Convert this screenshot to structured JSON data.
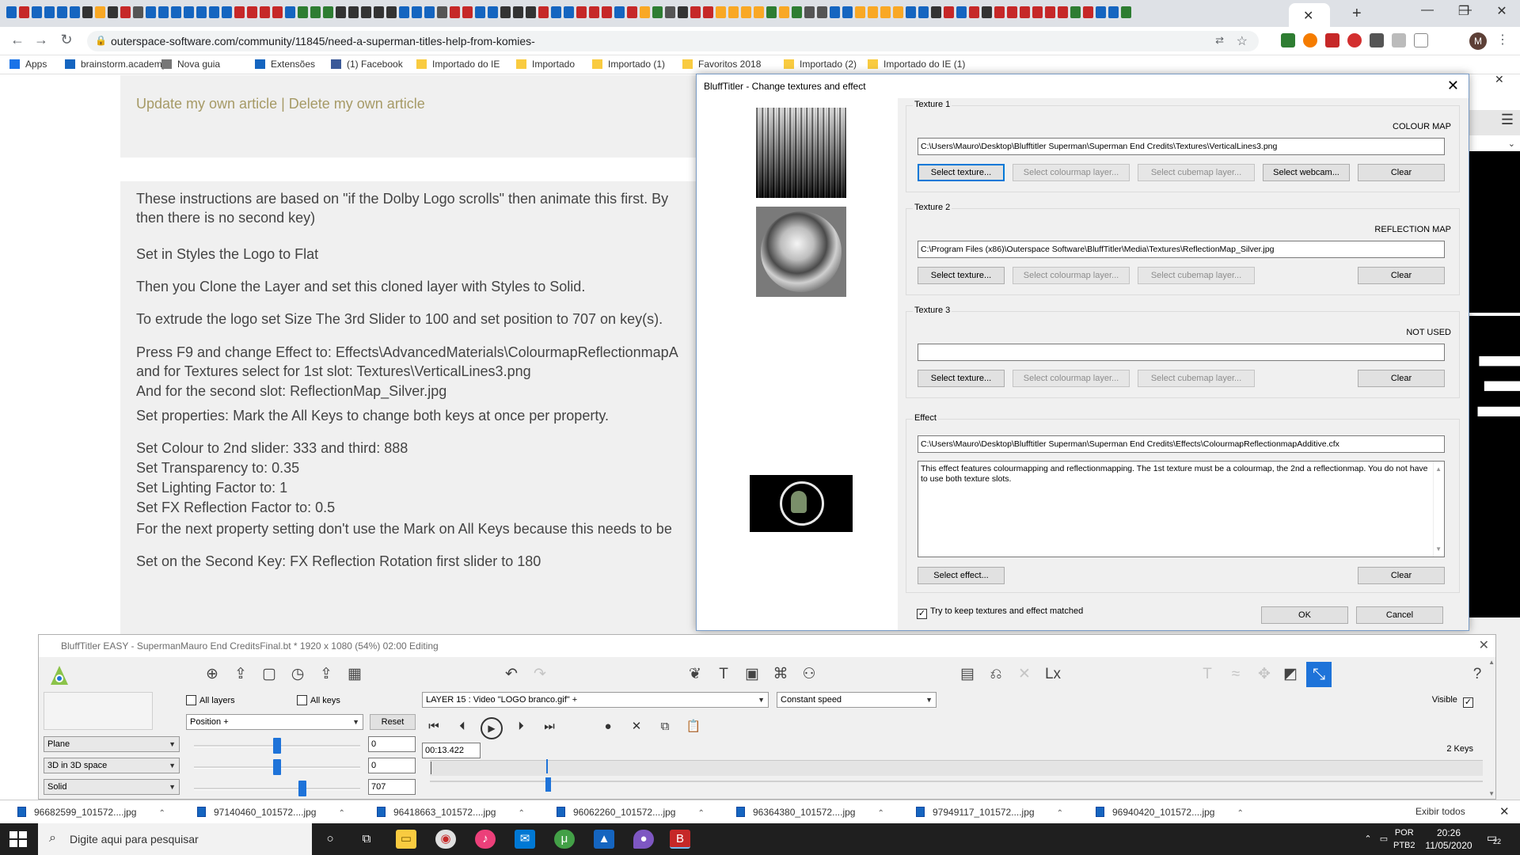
{
  "browser": {
    "favicon_colors": [
      "#1565c0",
      "#c62828",
      "#1565c0",
      "#1565c0",
      "#1565c0",
      "#1565c0",
      "#333333",
      "#f9a825",
      "#333333",
      "#c62828",
      "#555555",
      "#1565c0",
      "#1565c0",
      "#1565c0",
      "#1565c0",
      "#1565c0",
      "#1565c0",
      "#1565c0",
      "#c62828",
      "#c62828",
      "#c62828",
      "#c62828",
      "#1565c0",
      "#2e7d32",
      "#2e7d32",
      "#2e7d32",
      "#333333",
      "#333333",
      "#333333",
      "#333333",
      "#333333",
      "#1565c0",
      "#1565c0",
      "#1565c0",
      "#555555",
      "#c62828",
      "#c62828",
      "#1565c0",
      "#1565c0",
      "#333333",
      "#333333",
      "#333333",
      "#c62828",
      "#1565c0",
      "#1565c0",
      "#c62828",
      "#c62828",
      "#c62828",
      "#1565c0",
      "#c62828",
      "#f9a825",
      "#2e7d32",
      "#555555",
      "#333333",
      "#c62828",
      "#c62828",
      "#f9a825",
      "#f9a825",
      "#f9a825",
      "#f9a825",
      "#2e7d32",
      "#f9a825",
      "#2e7d32",
      "#555555",
      "#555555",
      "#1565c0",
      "#1565c0",
      "#f9a825",
      "#f9a825",
      "#f9a825",
      "#f9a825",
      "#1565c0",
      "#1565c0",
      "#333333",
      "#c62828",
      "#1565c0",
      "#c62828",
      "#333333",
      "#c62828",
      "#c62828",
      "#c62828",
      "#c62828",
      "#c62828",
      "#c62828",
      "#2e7d32",
      "#c62828",
      "#1565c0",
      "#1565c0",
      "#2e7d32"
    ],
    "active_tab_close": "✕",
    "new_tab": "+",
    "window_minimize": "—",
    "window_restore": "❐",
    "window_close": "✕",
    "back": "←",
    "forward": "→",
    "reload": "↻",
    "url": "outerspace-software.com/community/11845/need-a-superman-titles-help-from-komies-",
    "avatar_letter": "M",
    "bookmarks": [
      {
        "label": "Apps",
        "icon": "apps-icon",
        "color": "#1a73e8"
      },
      {
        "label": "brainstorm.academy",
        "icon": "arrow-icon",
        "color": "#1565c0"
      },
      {
        "label": "Nova guia",
        "icon": "globe-icon",
        "color": "#777777"
      },
      {
        "label": "Extensões",
        "icon": "puzzle-icon",
        "color": "#1565c0"
      },
      {
        "label": "(1) Facebook",
        "icon": "facebook-icon",
        "color": "#3b5998"
      },
      {
        "label": "Importado do IE",
        "icon": "folder-icon",
        "color": "#f9cb40"
      },
      {
        "label": "Importado",
        "icon": "folder-icon",
        "color": "#f9cb40"
      },
      {
        "label": "Importado (1)",
        "icon": "folder-icon",
        "color": "#f9cb40"
      },
      {
        "label": "Favoritos 2018",
        "icon": "folder-icon",
        "color": "#f9cb40"
      },
      {
        "label": "Importado (2)",
        "icon": "folder-icon",
        "color": "#f9cb40"
      },
      {
        "label": "Importado do IE (1)",
        "icon": "folder-icon",
        "color": "#f9cb40"
      }
    ]
  },
  "article": {
    "links": "Update my own article | Delete my own article",
    "lines": [
      "These instructions are based on \"if the Dolby Logo scrolls\" then animate this first. By",
      "then there is no second key)",
      "Set in Styles the Logo to Flat",
      "Then you Clone the Layer and set this cloned layer with Styles to Solid.",
      "To extrude the logo set Size The 3rd Slider to 100 and set position to 707 on key(s).",
      "Press F9 and change Effect to: Effects\\AdvancedMaterials\\ColourmapReflectionmapA",
      "and for Textures select for 1st slot: Textures\\VerticalLines3.png",
      "And for the second slot: ReflectionMap_Silver.jpg",
      "Set properties: Mark the All Keys to change both keys at once per property.",
      "Set Colour to 2nd slider: 333 and third: 888",
      "Set Transparency to: 0.35",
      "Set Lighting Factor to: 1",
      "Set FX Reflection Factor to: 0.5",
      "For the next property setting don't use the Mark on All Keys because this needs to be",
      "Set on the Second Key: FX Reflection Rotation first slider to 180"
    ]
  },
  "dialog": {
    "title": "BluffTitler - Change textures and effect",
    "close": "✕",
    "texture1": {
      "legend": "Texture 1",
      "map_type": "COLOUR MAP",
      "path": "C:\\Users\\Mauro\\Desktop\\Blufftitler Superman\\Superman End Credits\\Textures\\VerticalLines3.png",
      "select_texture": "Select texture...",
      "select_colourmap": "Select colourmap layer...",
      "select_cubemap": "Select cubemap layer...",
      "select_webcam": "Select webcam...",
      "clear": "Clear"
    },
    "texture2": {
      "legend": "Texture 2",
      "map_type": "REFLECTION MAP",
      "path": "C:\\Program Files (x86)\\Outerspace Software\\BluffTitler\\Media\\Textures\\ReflectionMap_Silver.jpg",
      "select_texture": "Select texture...",
      "select_colourmap": "Select colourmap layer...",
      "select_cubemap": "Select cubemap layer...",
      "clear": "Clear"
    },
    "texture3": {
      "legend": "Texture 3",
      "map_type": "NOT USED",
      "path": "",
      "select_texture": "Select texture...",
      "select_colourmap": "Select colourmap layer...",
      "select_cubemap": "Select cubemap layer...",
      "clear": "Clear"
    },
    "effect": {
      "legend": "Effect",
      "path": "C:\\Users\\Mauro\\Desktop\\Blufftitler Superman\\Superman End Credits\\Effects\\ColourmapReflectionmapAdditive.cfx",
      "description": "This effect features colourmapping and reflectionmapping. The 1st texture must be a colourmap, the 2nd a reflectionmap. You do not have to use both texture slots.",
      "select_effect": "Select effect...",
      "clear": "Clear"
    },
    "keep_matched": "Try to keep textures and effect matched",
    "keep_matched_checked": true,
    "ok": "OK",
    "cancel": "Cancel"
  },
  "blufftitler": {
    "title": "BluffTitler EASY - SupermanMauro End CreditsFinal.bt * 1920 x 1080 (54%) 02:00 Editing",
    "close": "✕",
    "all_layers": "All layers",
    "all_keys": "All keys",
    "property": "Position +",
    "reset": "Reset",
    "layer": "LAYER 15   : Video \"LOGO branco.gif\" +",
    "speed": "Constant speed",
    "visible": "Visible",
    "visible_checked": true,
    "time": "00:13.422",
    "keys": "2 Keys",
    "style1": "Plane",
    "style2": "3D in 3D space",
    "style3": "Solid",
    "slider1_fraction": 0.5,
    "slider2_fraction": 0.5,
    "slider3_fraction": 0.65,
    "value1": "0",
    "value2": "0",
    "value3": "707",
    "accent": "#1e73d9"
  },
  "downloads": {
    "files": [
      "96682599_101572....jpg",
      "97140460_101572....jpg",
      "96418663_101572....jpg",
      "96062260_101572....jpg",
      "96364380_101572....jpg",
      "97949117_101572....jpg",
      "96940420_101572....jpg"
    ],
    "show_all": "Exibir todos",
    "close": "✕"
  },
  "taskbar": {
    "search": "Digite aqui para pesquisar",
    "lang1": "POR",
    "lang2": "PTB2",
    "time": "20:26",
    "date": "11/05/2020",
    "notifications": "22"
  }
}
